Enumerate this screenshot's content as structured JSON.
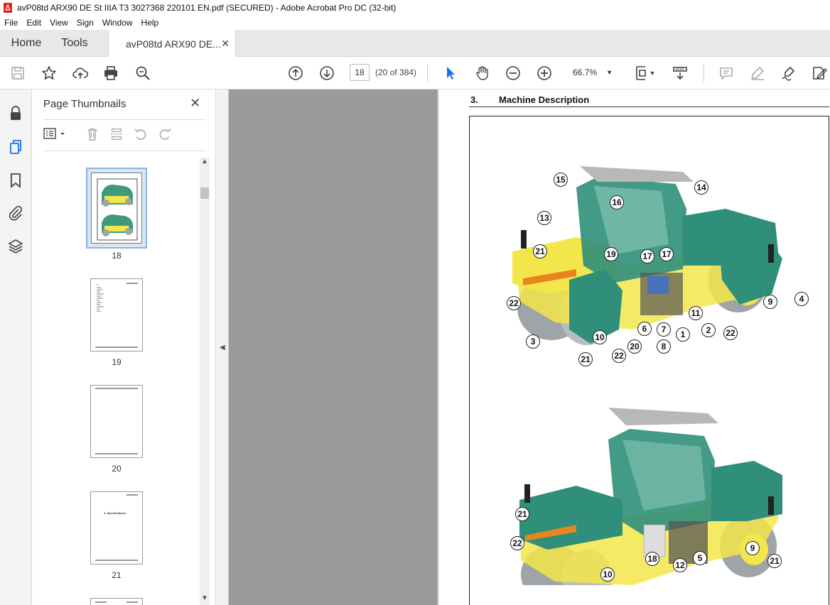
{
  "window": {
    "title": "avP08td ARX90 DE St IIIA T3 3027368 220101 EN.pdf (SECURED) - Adobe Acrobat Pro DC (32-bit)"
  },
  "menu": [
    "File",
    "Edit",
    "View",
    "Sign",
    "Window",
    "Help"
  ],
  "tabs": {
    "home": "Home",
    "tools": "Tools",
    "document": "avP08td ARX90 DE..."
  },
  "toolbar": {
    "page_number": "18",
    "page_of": "(20 of 384)",
    "zoom": "66.7%"
  },
  "thumbnails": {
    "title": "Page Thumbnails",
    "pages": [
      {
        "label": "18",
        "text": ""
      },
      {
        "label": "19",
        "text": ""
      },
      {
        "label": "20",
        "text": ""
      },
      {
        "label": "21",
        "text": "4. Specifications"
      }
    ]
  },
  "document": {
    "section_number": "3.",
    "section_title": "Machine Description",
    "figure_top_callouts": [
      "15",
      "14",
      "16",
      "13",
      "21",
      "19",
      "17",
      "17",
      "4",
      "22",
      "9",
      "11",
      "3",
      "10",
      "6",
      "7",
      "1",
      "2",
      "22",
      "8",
      "20",
      "22",
      "21"
    ],
    "figure_bottom_callouts": [
      "21",
      "22",
      "9",
      "21",
      "10",
      "18",
      "12",
      "5"
    ]
  },
  "colors": {
    "accent": "#1a73e8",
    "machine_green": "#2f8f7a",
    "machine_yellow": "#f3e64a",
    "drum_gray": "#9ea4a8"
  }
}
